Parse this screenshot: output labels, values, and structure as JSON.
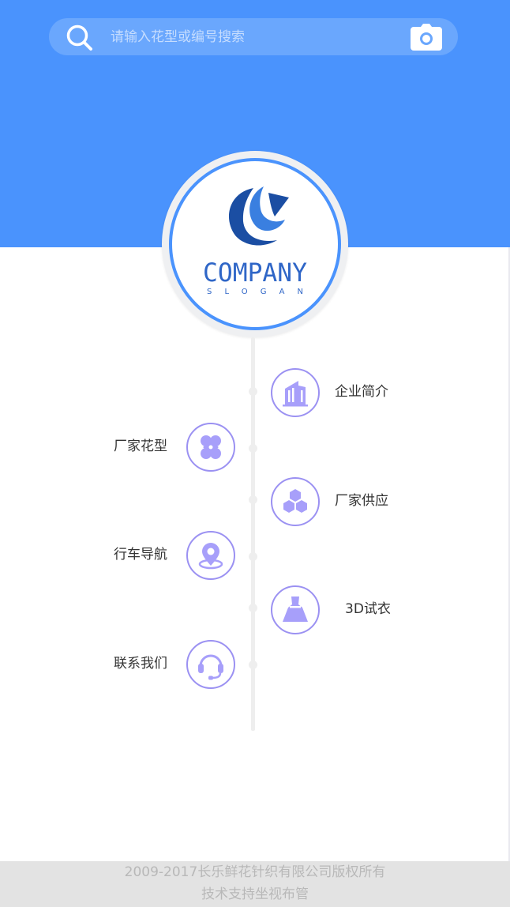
{
  "search": {
    "placeholder": "请输入花型或编号搜索",
    "search_icon": "search-icon",
    "camera_icon": "camera-icon"
  },
  "logo": {
    "name": "COMPANY",
    "slogan": "SLOGAN"
  },
  "menu": [
    {
      "label": "企业简介",
      "icon": "building-icon",
      "side": "right"
    },
    {
      "label": "厂家花型",
      "icon": "clover-icon",
      "side": "left"
    },
    {
      "label": "厂家供应",
      "icon": "hexagons-icon",
      "side": "right"
    },
    {
      "label": "行车导航",
      "icon": "location-pin-icon",
      "side": "left"
    },
    {
      "label": "3D试衣",
      "icon": "dress-icon",
      "side": "right"
    },
    {
      "label": "联系我们",
      "icon": "headset-icon",
      "side": "left"
    }
  ],
  "footer": {
    "line1": "2009-2017长乐鲜花针织有限公司版权所有",
    "line2": "技术支持坐视布管"
  },
  "colors": {
    "header": "#4a93fd",
    "accent": "#9b91f2",
    "icon_fill": "#a79ffa"
  }
}
